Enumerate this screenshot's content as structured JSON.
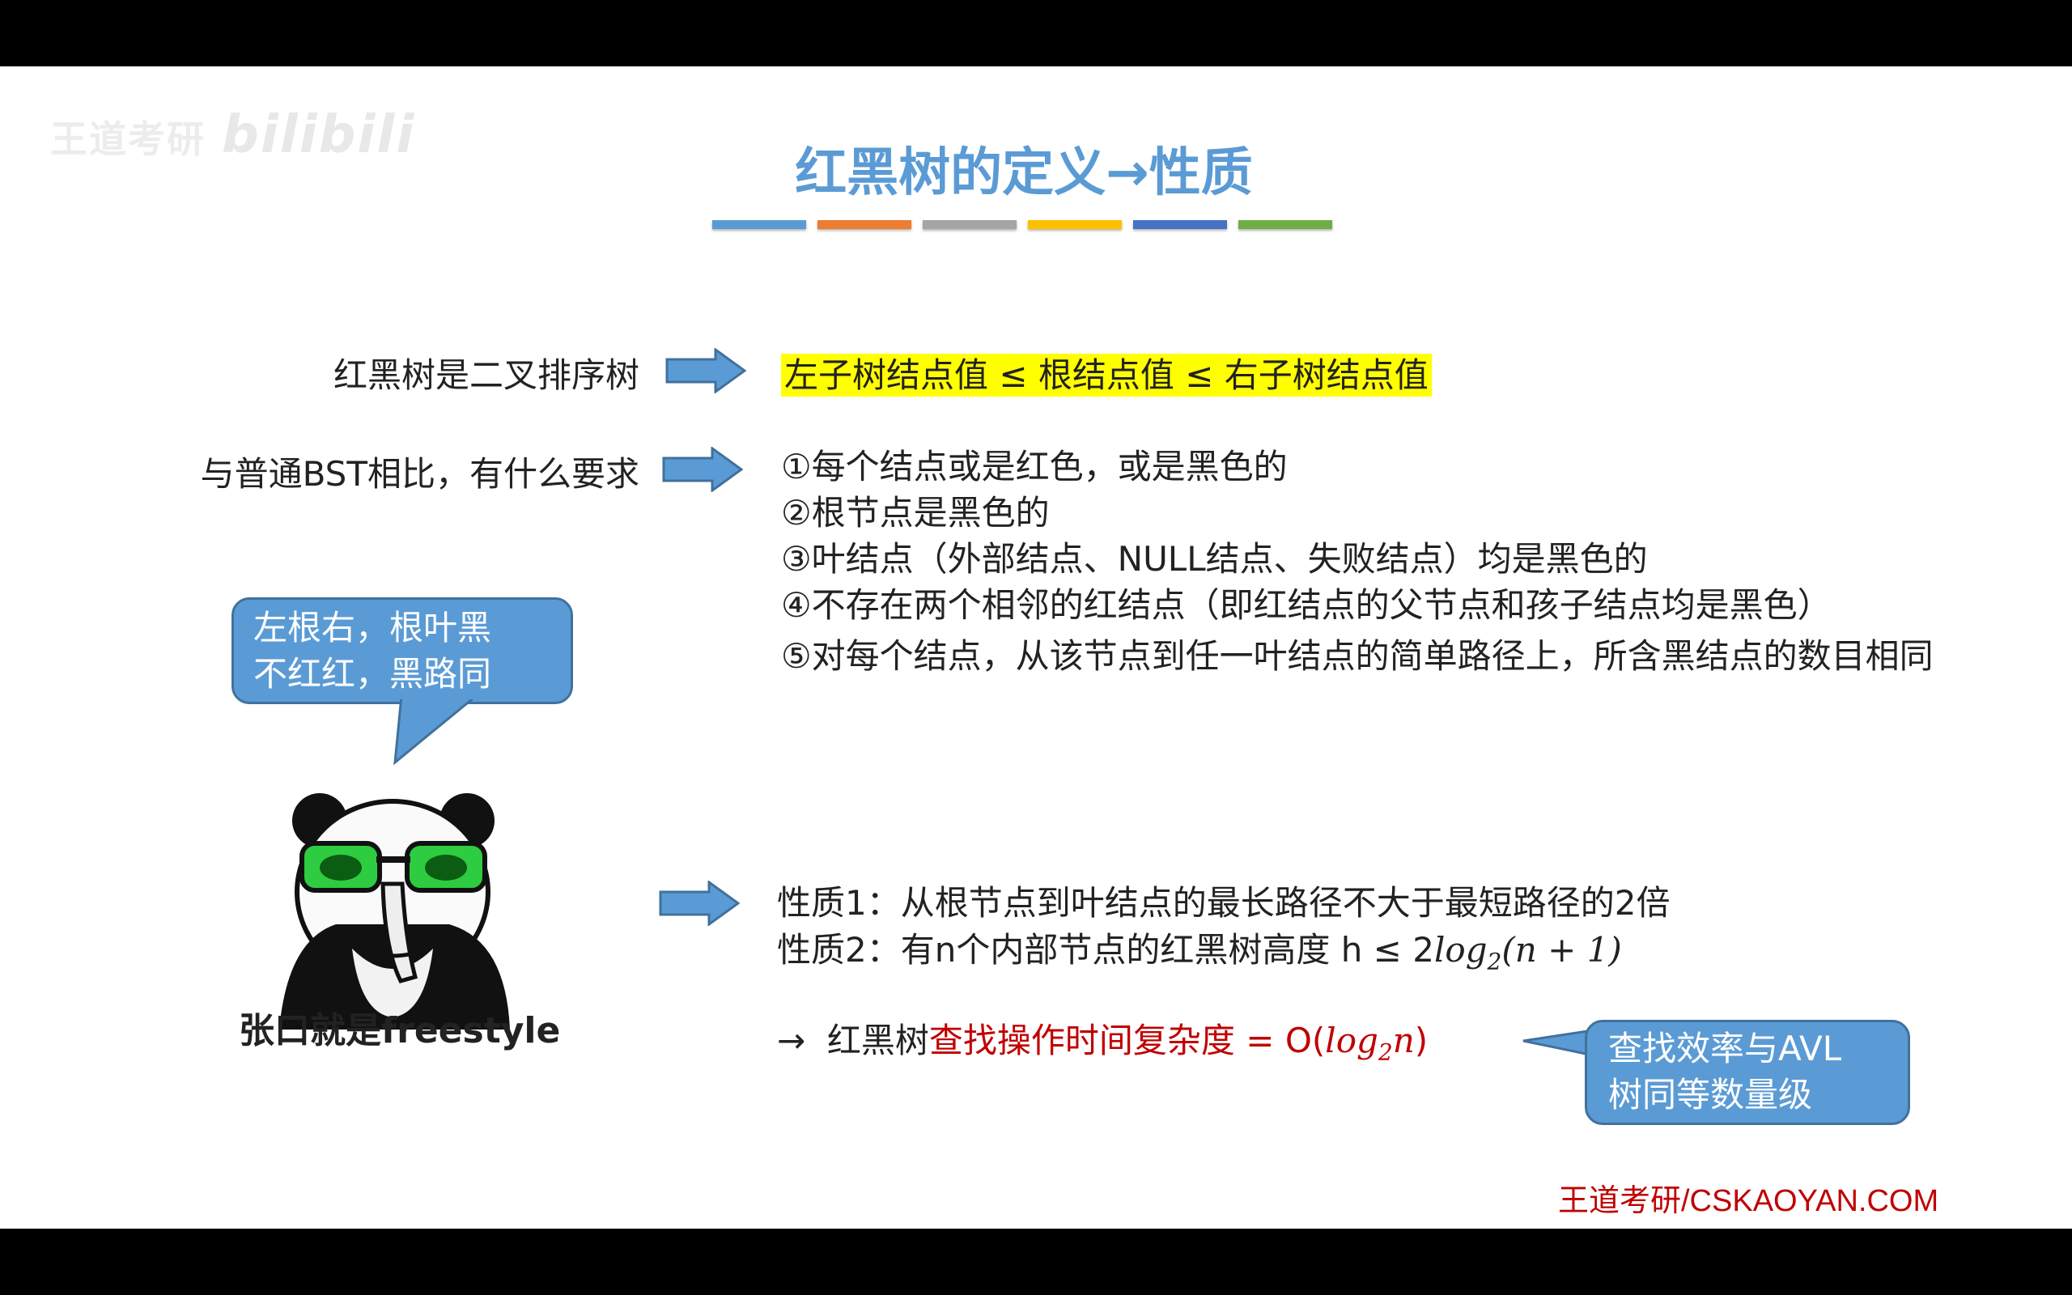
{
  "watermark": {
    "text1": "王道考研",
    "text2": "bilibili"
  },
  "title": "红黑树的定义→性质",
  "colorbar": [
    "#5b9bd5",
    "#ed7d31",
    "#a5a5a5",
    "#ffc000",
    "#4472c4",
    "#70ad47"
  ],
  "row1": {
    "label": "红黑树是二叉排序树",
    "value": "左子树结点值 ≤ 根结点值 ≤ 右子树结点值"
  },
  "row2": {
    "label": "与普通BST相比，有什么要求"
  },
  "rules": [
    "①每个结点或是红色，或是黑色的",
    "②根节点是黑色的",
    "③叶结点（外部结点、NULL结点、失败结点）均是黑色的",
    "④不存在两个相邻的红结点（即红结点的父节点和孩子结点均是黑色）",
    "⑤对每个结点，从该节点到任一叶结点的简单路径上，所含黑结点的数目相同"
  ],
  "bubble1": {
    "line1": "左根右，根叶黑",
    "line2": "不红红，黑路同"
  },
  "caption": "张口就是freestyle",
  "prop1": "性质1：从根节点到叶结点的最长路径不大于最短路径的2倍",
  "prop2": {
    "prefix": "性质2：有n个内部节点的红黑树高度 h ≤ 2",
    "log": "log",
    "sub": "2",
    "suffix": "(n + 1)"
  },
  "conclusion": {
    "arrow": "→",
    "prefix": "红黑树",
    "red": "查找操作时间复杂度 = O(",
    "log": "log",
    "sub": "2",
    "n": "n",
    "close": ")"
  },
  "bubble2": {
    "line1": "查找效率与AVL",
    "line2": "树同等数量级"
  },
  "brand": "王道考研/CSKAOYAN.COM",
  "colors": {
    "title": "#5b9bd5",
    "bubble": "#5b9bd5",
    "red": "#c00000",
    "highlight": "#ffff00"
  }
}
